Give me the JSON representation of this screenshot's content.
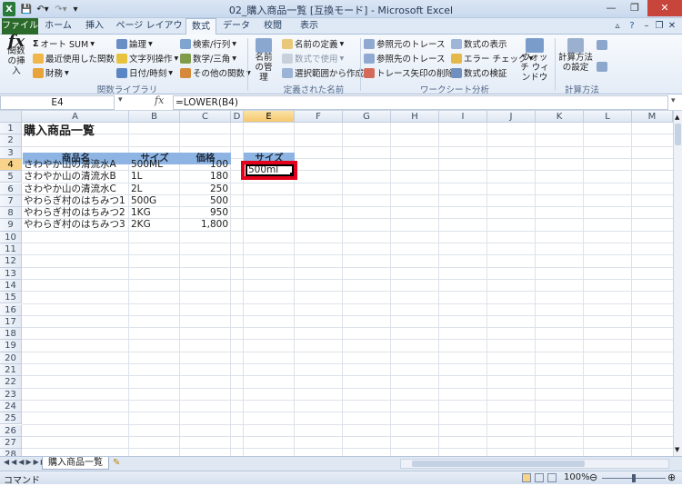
{
  "window": {
    "title": "02_購入商品一覧  [互換モード] - Microsoft Excel"
  },
  "tabs": [
    "ファイル",
    "ホーム",
    "挿入",
    "ページ レイアウト",
    "数式",
    "データ",
    "校閲",
    "表示"
  ],
  "ribbon": {
    "insert_function": "関数の挿入",
    "autosum": "オート SUM",
    "recent": "最近使用した関数",
    "financial": "財務",
    "logical": "論理",
    "text": "文字列操作",
    "datetime": "日付/時刻",
    "lookup": "検索/行列",
    "math": "数学/三角",
    "more": "その他の関数",
    "group_library": "関数ライブラリ",
    "name_manager": "名前の管理",
    "define_name": "名前の定義",
    "use_in_formula": "数式で使用",
    "create_from_sel": "選択範囲から作成",
    "group_names": "定義された名前",
    "trace_prec": "参照元のトレース",
    "trace_dep": "参照先のトレース",
    "remove_arrows": "トレース矢印の削除",
    "show_formulas": "数式の表示",
    "error_check": "エラー チェック",
    "evaluate": "数式の検証",
    "watch": "ウォッチ ウィンドウ",
    "group_audit": "ワークシート分析",
    "calc_options": "計算方法の設定",
    "group_calc": "計算方法"
  },
  "formula_bar": {
    "name_box": "E4",
    "fx": "fx",
    "formula": "=LOWER(B4)"
  },
  "columns": [
    "A",
    "B",
    "C",
    "D",
    "E",
    "F",
    "G",
    "H",
    "I",
    "J",
    "K",
    "L",
    "M"
  ],
  "rows": [
    "1",
    "2",
    "3",
    "4",
    "5",
    "6",
    "7",
    "8",
    "9",
    "10",
    "11",
    "12",
    "13",
    "14",
    "15",
    "16",
    "17",
    "18",
    "19",
    "20",
    "21",
    "22",
    "23",
    "24",
    "25",
    "26",
    "27",
    "28"
  ],
  "sheet": {
    "title": "購入商品一覧",
    "headers": [
      "商品名",
      "サイズ",
      "価格"
    ],
    "e3_header": "サイズ",
    "e4_value": "500ml",
    "data": [
      [
        "さわやか山の清流水A",
        "500ML",
        "100"
      ],
      [
        "さわやか山の清流水B",
        "1L",
        "180"
      ],
      [
        "さわやか山の清流水C",
        "2L",
        "250"
      ],
      [
        "やわらぎ村のはちみつ1",
        "500G",
        "500"
      ],
      [
        "やわらぎ村のはちみつ2",
        "1KG",
        "950"
      ],
      [
        "やわらぎ村のはちみつ3",
        "2KG",
        "1,800"
      ]
    ]
  },
  "sheet_tab": "購入商品一覧",
  "status": {
    "mode": "コマンド",
    "zoom": "100%"
  },
  "colors": {
    "header_fill": "#8db4e2",
    "highlight_border": "#e3001b",
    "file_tab": "#2a6a2a"
  }
}
